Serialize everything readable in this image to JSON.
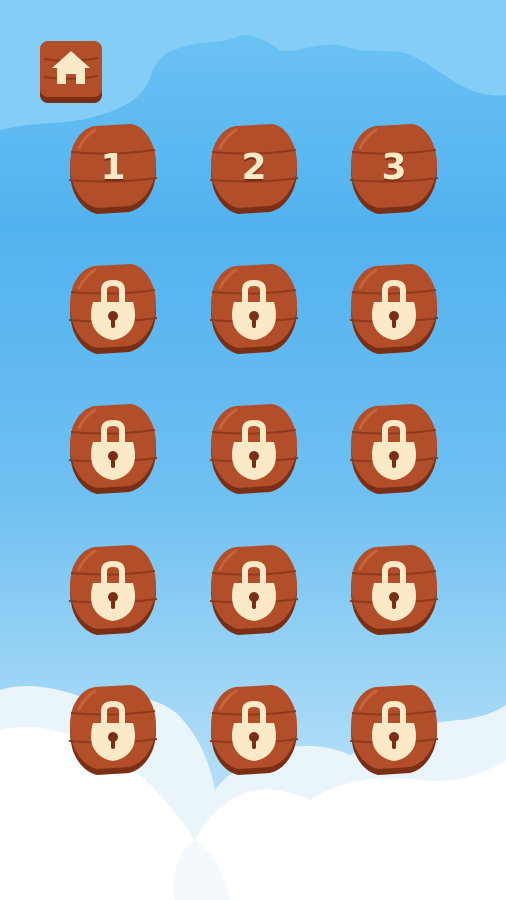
{
  "home_button": {
    "icon": "home-icon"
  },
  "colors": {
    "sky_top": "#6fc4f4",
    "sky_bottom": "#cfe9f9",
    "wood": "#b24e2a",
    "wood_dark": "#7a2e14",
    "lock": "#fbe9c8"
  },
  "levels": [
    {
      "label": "1",
      "locked": false
    },
    {
      "label": "2",
      "locked": false
    },
    {
      "label": "3",
      "locked": false
    },
    {
      "label": "",
      "locked": true,
      "icon": "lock-icon"
    },
    {
      "label": "",
      "locked": true,
      "icon": "lock-icon"
    },
    {
      "label": "",
      "locked": true,
      "icon": "lock-icon"
    },
    {
      "label": "",
      "locked": true,
      "icon": "lock-icon"
    },
    {
      "label": "",
      "locked": true,
      "icon": "lock-icon"
    },
    {
      "label": "",
      "locked": true,
      "icon": "lock-icon"
    },
    {
      "label": "",
      "locked": true,
      "icon": "lock-icon"
    },
    {
      "label": "",
      "locked": true,
      "icon": "lock-icon"
    },
    {
      "label": "",
      "locked": true,
      "icon": "lock-icon"
    },
    {
      "label": "",
      "locked": true,
      "icon": "lock-icon"
    },
    {
      "label": "",
      "locked": true,
      "icon": "lock-icon"
    },
    {
      "label": "",
      "locked": true,
      "icon": "lock-icon"
    }
  ]
}
